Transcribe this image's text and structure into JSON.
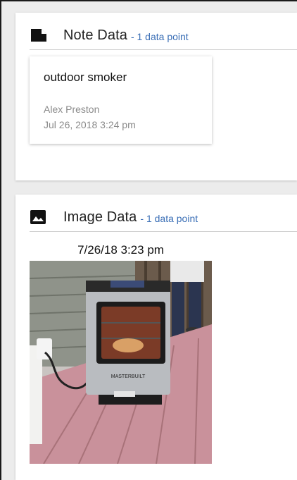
{
  "note_section": {
    "title": "Note Data",
    "count": "- 1 data point",
    "icon": "note-icon",
    "note": {
      "text": "outdoor smoker",
      "author": "Alex Preston",
      "date": "Jul 26, 2018 3:24 pm"
    }
  },
  "image_section": {
    "title": "Image Data",
    "count": "- 1 data point",
    "icon": "image-icon",
    "photo": {
      "timestamp": "7/26/18 3:23 pm",
      "brand_label": "MASTERBUILT"
    }
  },
  "colors": {
    "accent": "#3b6fb6",
    "deck": "#c98f9a",
    "siding": "#8c8f86"
  }
}
